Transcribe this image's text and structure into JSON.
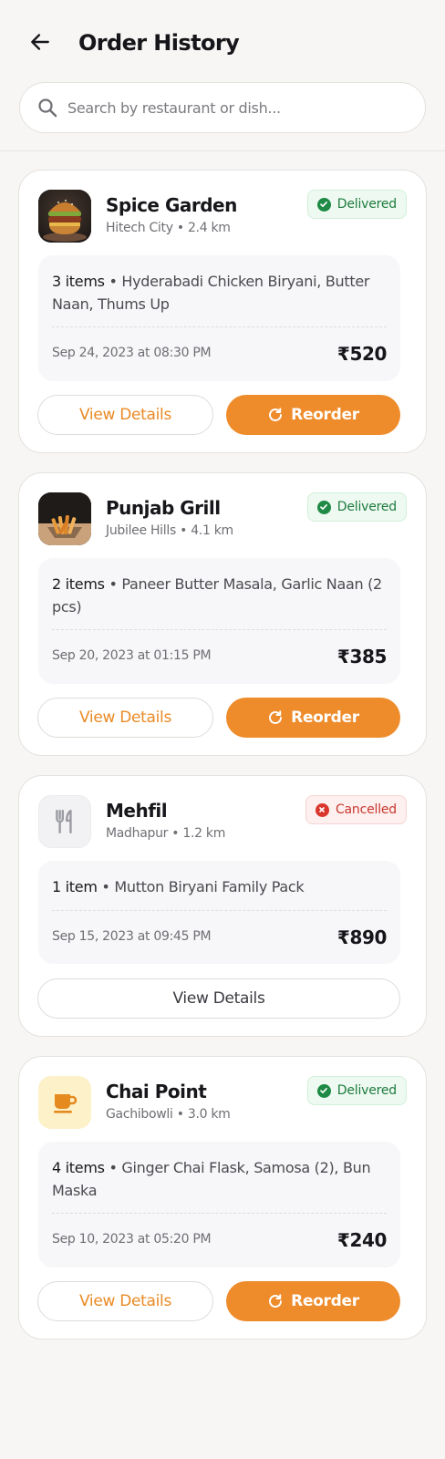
{
  "header": {
    "title": "Order History",
    "back_icon": "arrow-left-icon"
  },
  "search": {
    "placeholder": "Search by restaurant or dish...",
    "value": "",
    "icon": "search-icon"
  },
  "colors": {
    "accent": "#ee8c2c",
    "delivered": "#1e8a45",
    "cancelled": "#d9362c"
  },
  "orders": [
    {
      "restaurant": "Spice Garden",
      "location": "Hitech City",
      "distance": "2.4 km",
      "status": "Delivered",
      "item_count": "3 items",
      "items": "Hyderabadi Chicken Biryani, Butter Naan, Thums Up",
      "date": "Sep 24, 2023 at 08:30 PM",
      "total": "₹520",
      "view_label": "View Details",
      "reorder_label": "Reorder",
      "thumbnail": "burger-photo"
    },
    {
      "restaurant": "Punjab Grill",
      "location": "Jubilee Hills",
      "distance": "4.1 km",
      "status": "Delivered",
      "item_count": "2 items",
      "items": "Paneer Butter Masala, Garlic Naan (2 pcs)",
      "date": "Sep 20, 2023 at 01:15 PM",
      "total": "₹385",
      "view_label": "View Details",
      "reorder_label": "Reorder",
      "thumbnail": "fries-photo"
    },
    {
      "restaurant": "Mehfil",
      "location": "Madhapur",
      "distance": "1.2 km",
      "status": "Cancelled",
      "item_count": "1 item",
      "items": "Mutton Biryani Family Pack",
      "date": "Sep 15, 2023 at 09:45 PM",
      "total": "₹890",
      "view_label": "View Details",
      "thumbnail": "utensils-icon"
    },
    {
      "restaurant": "Chai Point",
      "location": "Gachibowli",
      "distance": "3.0 km",
      "status": "Delivered",
      "item_count": "4 items",
      "items": "Ginger Chai Flask, Samosa (2), Bun Maska",
      "date": "Sep 10, 2023 at 05:20 PM",
      "total": "₹240",
      "view_label": "View Details",
      "reorder_label": "Reorder",
      "thumbnail": "coffee-cup-icon"
    }
  ]
}
